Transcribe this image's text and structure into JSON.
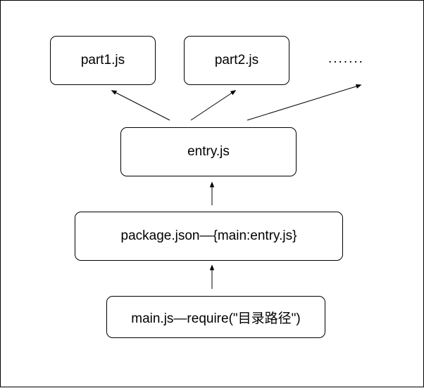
{
  "nodes": {
    "part1": "part1.js",
    "part2": "part2.js",
    "more": ".......",
    "entry": "entry.js",
    "package": "package.json—{main:entry.js}",
    "main": "main.js—require(\"目录路径\")"
  },
  "colors": {
    "stroke": "#000000",
    "fill": "#ffffff"
  }
}
